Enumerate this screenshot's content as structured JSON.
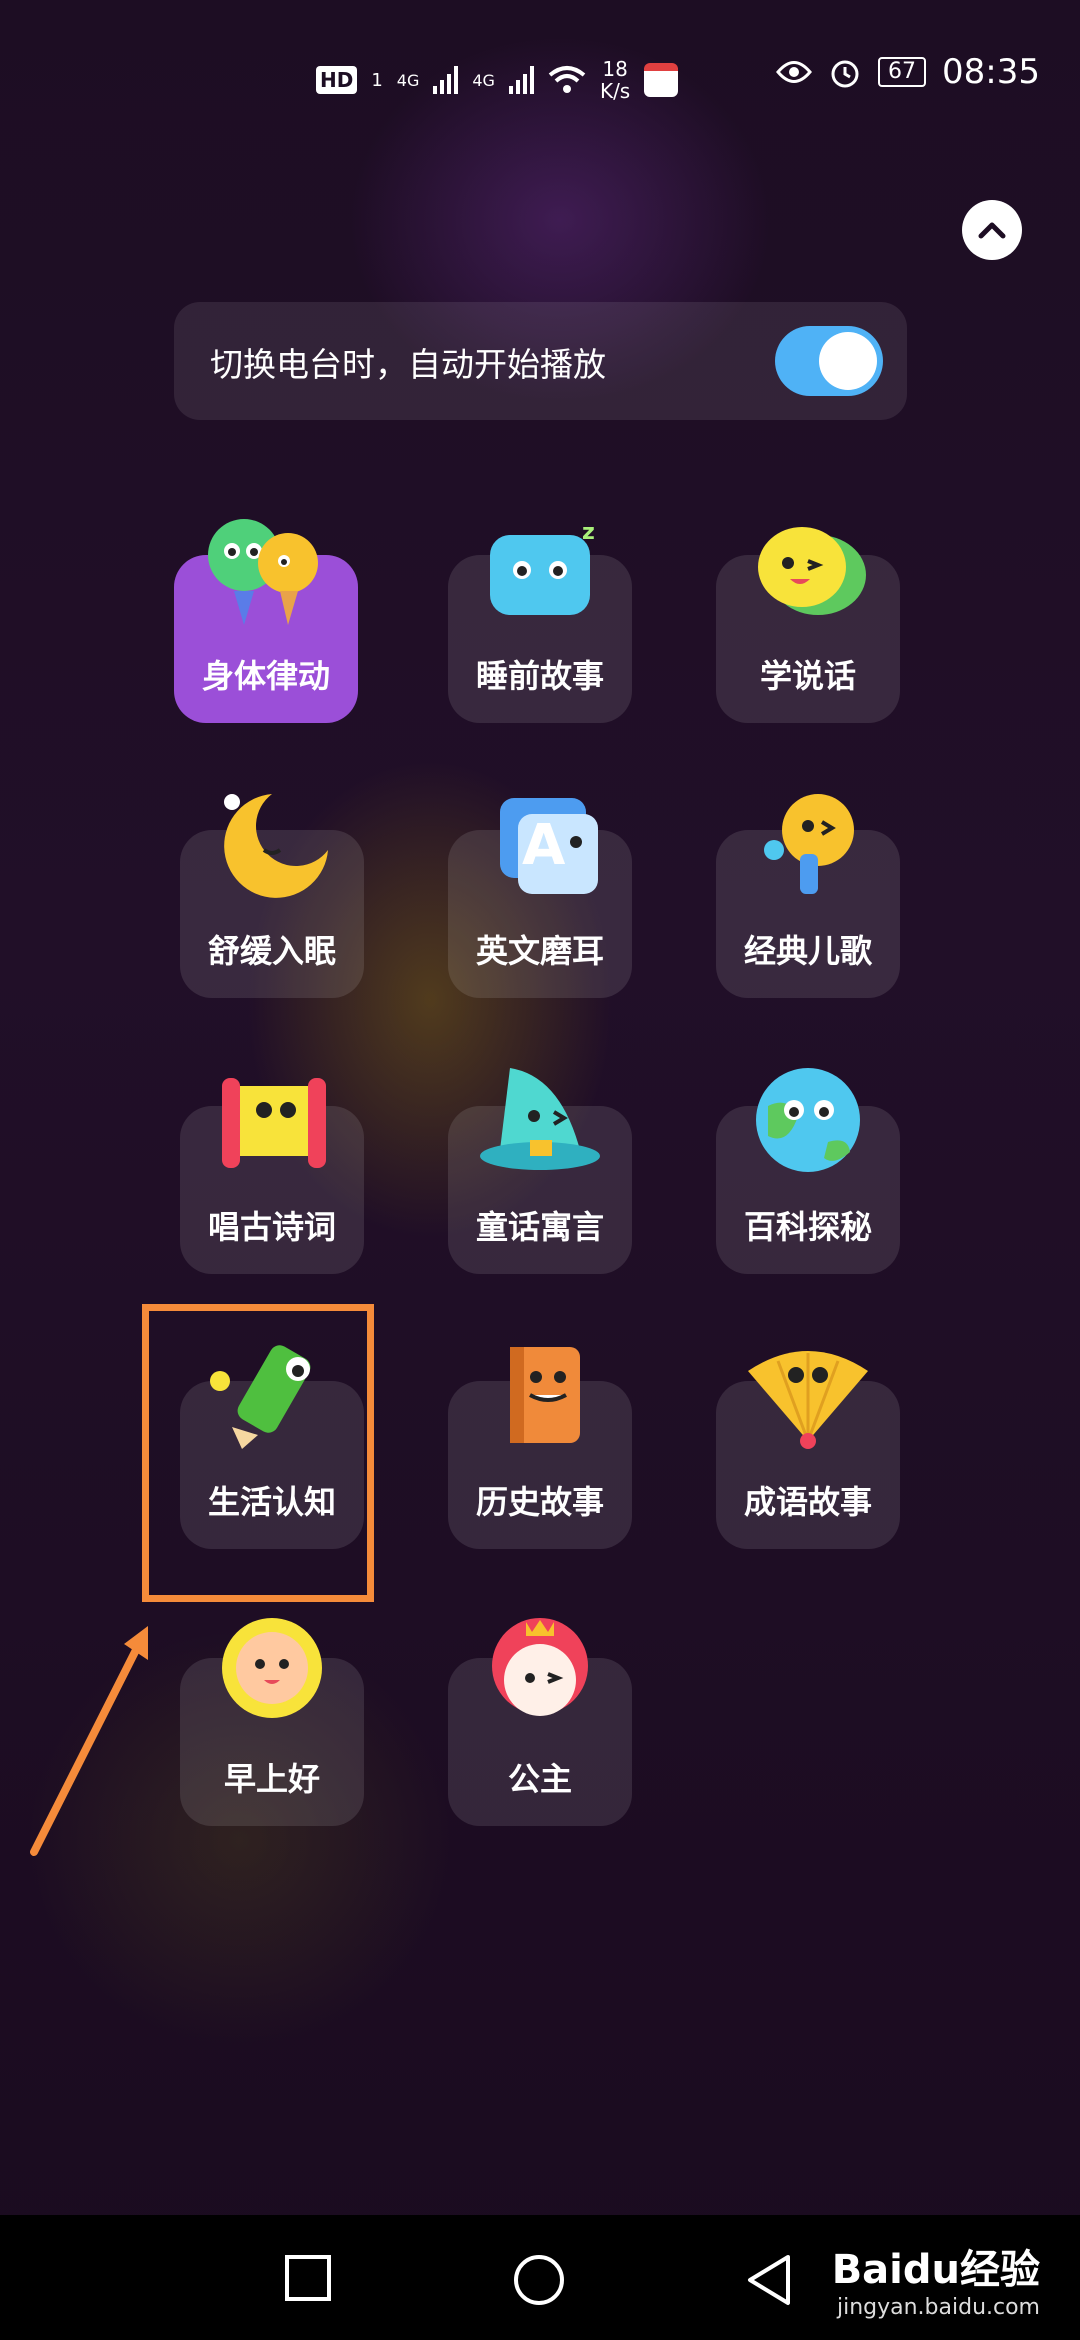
{
  "status_bar": {
    "hd": "HD",
    "sim_a": "1",
    "net1": "4G",
    "net2": "4G",
    "speed_value": "18",
    "speed_unit": "K/s",
    "battery": "67",
    "time": "08:35"
  },
  "toggle": {
    "label": "切换电台时，自动开始播放",
    "on": true,
    "color_on": "#4fb2f6"
  },
  "tiles": [
    {
      "label": "身体律动",
      "icon": "microphone-duo-icon",
      "selected": true
    },
    {
      "label": "睡前故事",
      "icon": "sleepy-cloud-icon",
      "selected": false
    },
    {
      "label": "学说话",
      "icon": "chat-bubble-icon",
      "selected": false
    },
    {
      "label": "舒缓入眠",
      "icon": "crescent-moon-icon",
      "selected": false
    },
    {
      "label": "英文磨耳",
      "icon": "letter-a-card-icon",
      "selected": false
    },
    {
      "label": "经典儿歌",
      "icon": "singing-mic-icon",
      "selected": false
    },
    {
      "label": "唱古诗词",
      "icon": "scroll-icon",
      "selected": false
    },
    {
      "label": "童话寓言",
      "icon": "wizard-hat-icon",
      "selected": false
    },
    {
      "label": "百科探秘",
      "icon": "globe-icon",
      "selected": false
    },
    {
      "label": "生活认知",
      "icon": "pencil-icon",
      "selected": false
    },
    {
      "label": "历史故事",
      "icon": "book-icon",
      "selected": false
    },
    {
      "label": "成语故事",
      "icon": "folding-fan-icon",
      "selected": false
    },
    {
      "label": "早上好",
      "icon": "sun-icon",
      "selected": false
    },
    {
      "label": "公主",
      "icon": "princess-icon",
      "selected": false
    }
  ],
  "watermark": {
    "logo": "Baidu经验",
    "url": "jingyan.baidu.com"
  },
  "colors": {
    "selected_tile": "#9b4fd8",
    "highlight": "#f58b3a"
  }
}
